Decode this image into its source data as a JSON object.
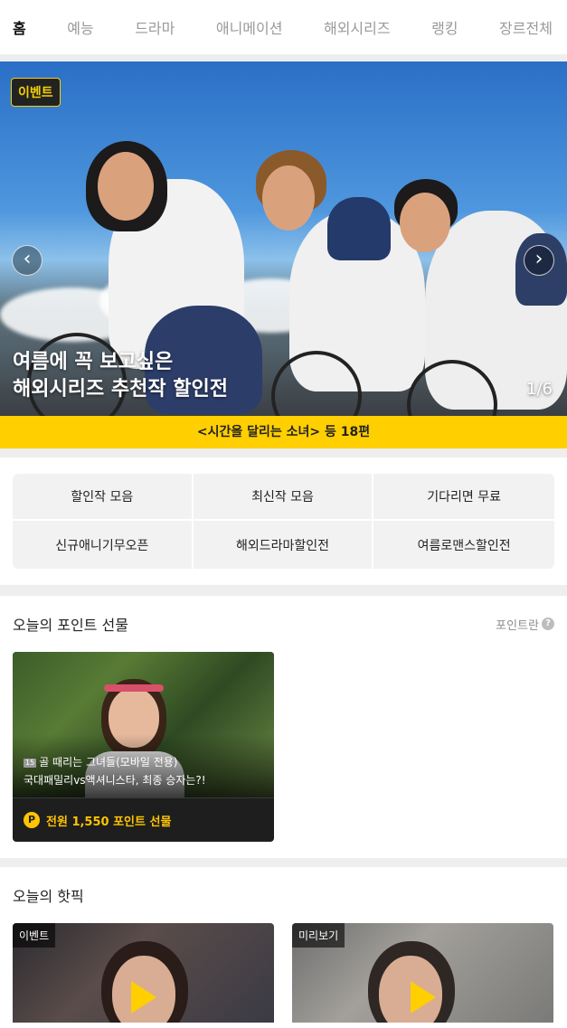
{
  "tabs": [
    "홈",
    "예능",
    "드라마",
    "애니메이션",
    "해외시리즈",
    "랭킹",
    "장르전체"
  ],
  "banner": {
    "tag": "이벤트",
    "title_line1": "여름에 꼭 보고싶은",
    "title_line2": "해외시리즈 추천작 할인전",
    "counter": "1/6",
    "prev_icon": "chevron-left-icon",
    "next_icon": "chevron-right-icon",
    "subtitle": "<시간을 달리는 소녀> 등 18편"
  },
  "categories": [
    {
      "label": "할인작 모음"
    },
    {
      "label": "최신작 모음"
    },
    {
      "label": "기다리면 무료"
    },
    {
      "label": "신규애니기무오픈"
    },
    {
      "label": "해외드라마할인전"
    },
    {
      "label": "여름로맨스할인전"
    }
  ],
  "point_gift": {
    "title": "오늘의 포인트 선물",
    "link": "포인트란",
    "help_icon": "question-icon",
    "card": {
      "age": "15",
      "line1": "골 때리는 그녀들(모바일 전용)",
      "line2": "국대패밀리vs액셔니스타, 최종 승자는?!",
      "coin_icon": "point-coin-icon",
      "coin_letter": "P",
      "reward": "전원 1,550 포인트 선물"
    }
  },
  "hot_pick": {
    "title": "오늘의 핫픽",
    "items": [
      {
        "tag": "이벤트"
      },
      {
        "tag": "미리보기"
      }
    ]
  },
  "colors": {
    "accent": "#ffcf00",
    "active_tab": "#111111",
    "inactive_tab": "#9a9a9a"
  }
}
